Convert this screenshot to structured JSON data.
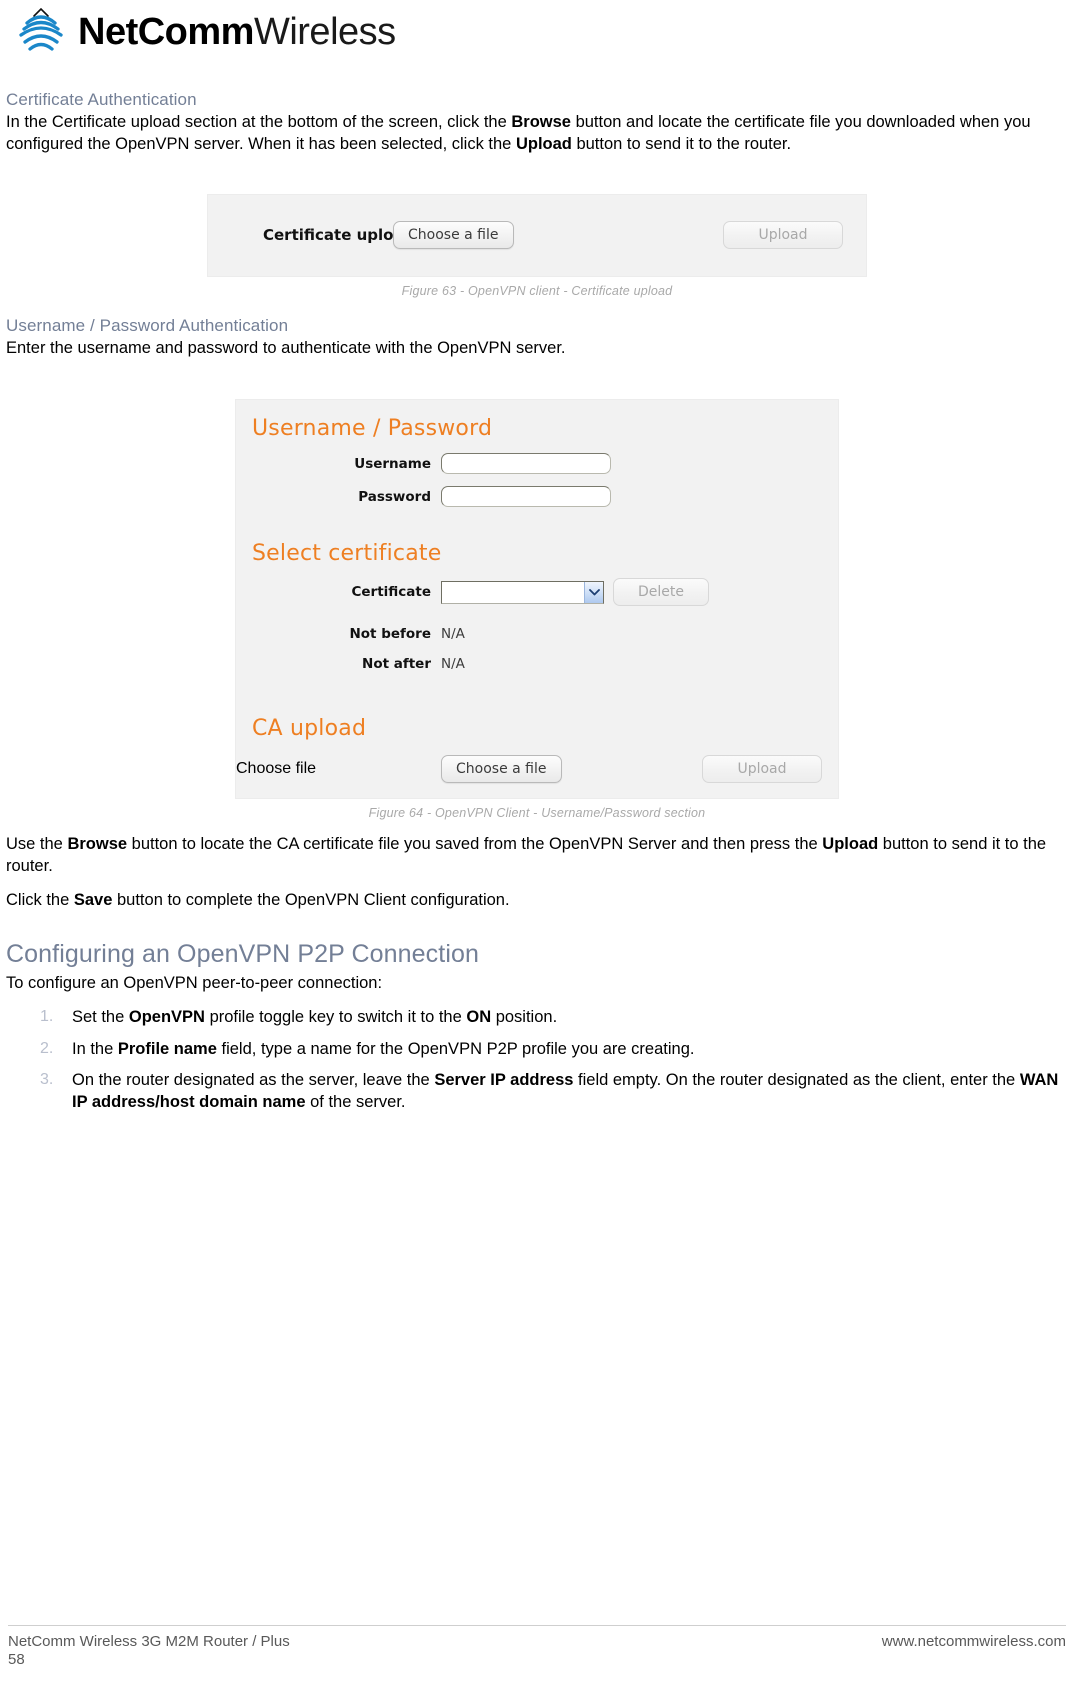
{
  "brand": {
    "name_bold": "NetComm",
    "name_light": "Wireless",
    "logo_color": "#1b87c9"
  },
  "sections": {
    "certificate_auth": {
      "heading": "Certificate Authentication",
      "paragraph_pre": "In the Certificate upload section at the bottom of the screen, click the ",
      "bold_browse": "Browse",
      "paragraph_mid": " button and locate the certificate file you downloaded when you configured the OpenVPN server. When it has been selected, click the ",
      "bold_upload": "Upload",
      "paragraph_post": " button to send it to the router."
    },
    "username_password_auth": {
      "heading": "Username / Password Authentication",
      "paragraph": "Enter the username and password to authenticate with the OpenVPN server."
    },
    "after_fig64": {
      "p1_pre": "Use the ",
      "p1_b1": "Browse",
      "p1_mid": " button to locate the CA certificate file you saved from the OpenVPN Server and then press the ",
      "p1_b2": "Upload",
      "p1_post": " button to send it to the router.",
      "p2_pre": "Click the ",
      "p2_b1": "Save",
      "p2_post": " button to complete the OpenVPN Client configuration."
    },
    "p2p": {
      "heading": "Configuring an OpenVPN P2P Connection",
      "intro": "To configure an OpenVPN peer-to-peer connection:",
      "steps": [
        {
          "pre": "Set the ",
          "b1": "OpenVPN",
          "mid": " profile toggle key to switch it to the ",
          "b2": "ON",
          "post": " position."
        },
        {
          "pre": "In the ",
          "b1": "Profile name",
          "mid": " field, type a name for the OpenVPN P2P profile you are creating.",
          "b2": "",
          "post": ""
        },
        {
          "pre": "On the router designated as the server, leave the ",
          "b1": "Server IP address",
          "mid": " field empty. On the router designated as the client, enter the ",
          "b2": "WAN IP address/host domain name",
          "post": " of the server."
        }
      ]
    }
  },
  "figure63": {
    "caption": "Figure 63 - OpenVPN client - Certificate upload",
    "label": "Certificate upload",
    "choose_button": "Choose a file",
    "upload_button": "Upload"
  },
  "figure64": {
    "caption": "Figure 64 - OpenVPN Client - Username/Password section",
    "heading_userpass": "Username / Password",
    "label_username": "Username",
    "value_username": "",
    "label_password": "Password",
    "value_password": "",
    "heading_select_cert": "Select certificate",
    "label_certificate": "Certificate",
    "value_certificate": "",
    "delete_button": "Delete",
    "label_not_before": "Not before",
    "value_not_before": "N/A",
    "label_not_after": "Not after",
    "value_not_after": "N/A",
    "heading_ca_upload": "CA upload",
    "label_choose_file": "Choose file",
    "choose_button": "Choose a file",
    "upload_button": "Upload",
    "accent_color": "#ee7f22"
  },
  "footer": {
    "left": "NetComm Wireless 3G M2M Router / Plus",
    "page_number": "58",
    "right": "www.netcommwireless.com"
  }
}
